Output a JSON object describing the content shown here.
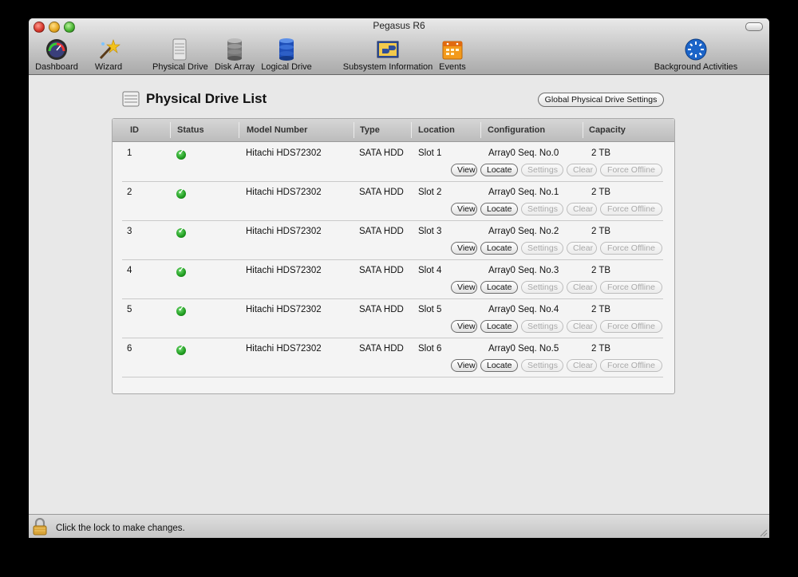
{
  "window": {
    "title": "Pegasus R6"
  },
  "toolbar": {
    "dashboard": "Dashboard",
    "wizard": "Wizard",
    "physical_drive": "Physical Drive",
    "disk_array": "Disk Array",
    "logical_drive": "Logical Drive",
    "subsystem_information": "Subsystem Information",
    "events": "Events",
    "background_activities": "Background Activities"
  },
  "page": {
    "title": "Physical Drive List",
    "global_settings_label": "Global Physical Drive Settings"
  },
  "table": {
    "columns": [
      "ID",
      "Status",
      "Model Number",
      "Type",
      "Location",
      "Configuration",
      "Capacity"
    ],
    "rows": [
      {
        "id": "1",
        "status": "ok",
        "model": "Hitachi HDS72302",
        "type": "SATA HDD",
        "location": "Slot 1",
        "configuration": "Array0 Seq. No.0",
        "capacity": "2 TB"
      },
      {
        "id": "2",
        "status": "ok",
        "model": "Hitachi HDS72302",
        "type": "SATA HDD",
        "location": "Slot 2",
        "configuration": "Array0 Seq. No.1",
        "capacity": "2 TB"
      },
      {
        "id": "3",
        "status": "ok",
        "model": "Hitachi HDS72302",
        "type": "SATA HDD",
        "location": "Slot 3",
        "configuration": "Array0 Seq. No.2",
        "capacity": "2 TB"
      },
      {
        "id": "4",
        "status": "ok",
        "model": "Hitachi HDS72302",
        "type": "SATA HDD",
        "location": "Slot 4",
        "configuration": "Array0 Seq. No.3",
        "capacity": "2 TB"
      },
      {
        "id": "5",
        "status": "ok",
        "model": "Hitachi HDS72302",
        "type": "SATA HDD",
        "location": "Slot 5",
        "configuration": "Array0 Seq. No.4",
        "capacity": "2 TB"
      },
      {
        "id": "6",
        "status": "ok",
        "model": "Hitachi HDS72302",
        "type": "SATA HDD",
        "location": "Slot 6",
        "configuration": "Array0 Seq. No.5",
        "capacity": "2 TB"
      }
    ],
    "actions": {
      "view": "View",
      "locate": "Locate",
      "settings": "Settings",
      "clear": "Clear",
      "force_offline": "Force Offline"
    }
  },
  "statusbar": {
    "lock_text": "Click the lock to make changes."
  },
  "colors": {
    "status_ok": "#1e9a1e",
    "toolbar_bg": "#c6c6c6",
    "content_bg": "#e8e8e8"
  },
  "icons": [
    "dashboard-icon",
    "wizard-icon",
    "physical-drive-icon",
    "disk-array-icon",
    "logical-drive-icon",
    "subsystem-information-icon",
    "events-icon",
    "background-activities-icon",
    "lock-icon"
  ]
}
